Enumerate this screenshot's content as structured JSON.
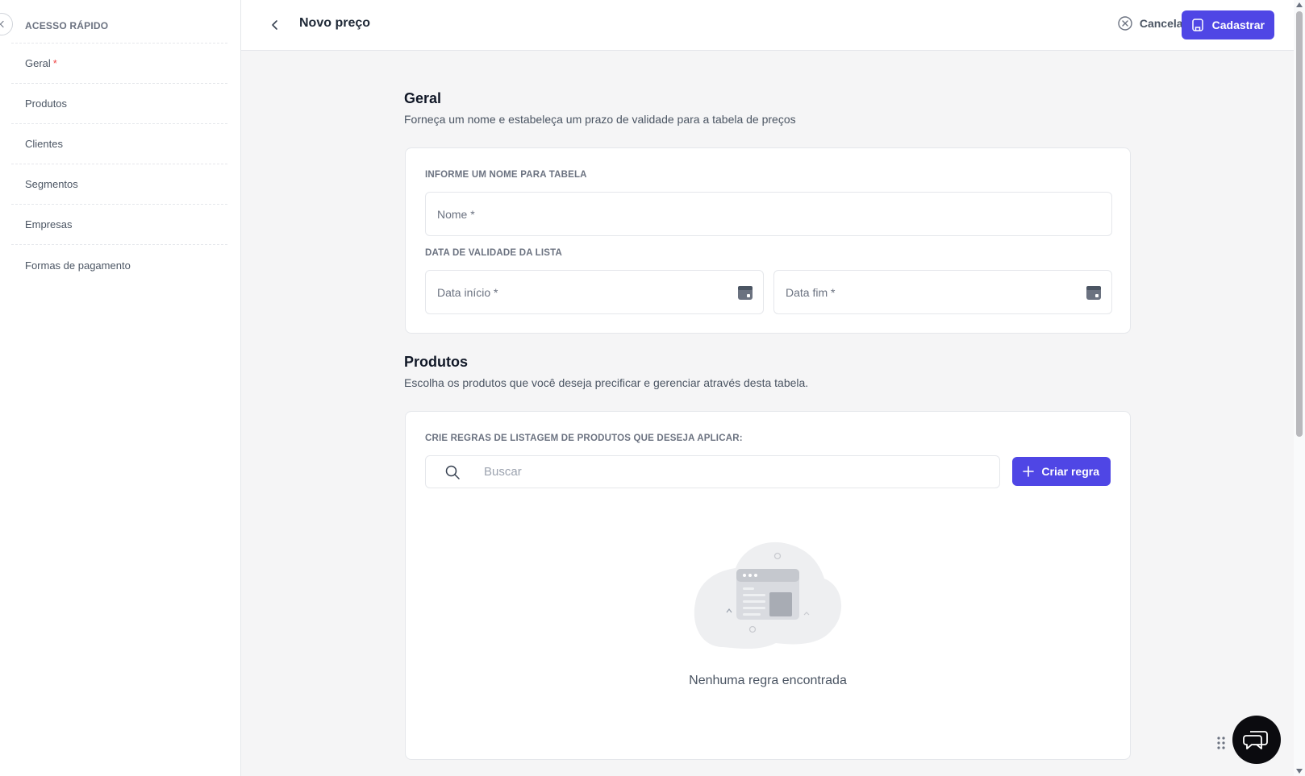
{
  "sidebar": {
    "heading": "ACESSO RÁPIDO",
    "items": [
      {
        "label": "Geral",
        "required": "*"
      },
      {
        "label": "Produtos"
      },
      {
        "label": "Clientes"
      },
      {
        "label": "Segmentos"
      },
      {
        "label": "Empresas"
      },
      {
        "label": "Formas de pagamento"
      }
    ]
  },
  "header": {
    "title": "Novo preço",
    "cancel_label": "Cancelar",
    "submit_label": "Cadastrar"
  },
  "general": {
    "title": "Geral",
    "description": "Forneça um nome e estabeleça um prazo de validade para a tabela de preços",
    "name_label": "INFORME UM NOME PARA TABELA",
    "name_placeholder": "Nome *",
    "validity_label": "DATA DE VALIDADE DA LISTA",
    "start_placeholder": "Data início *",
    "end_placeholder": "Data fim *"
  },
  "products": {
    "title": "Produtos",
    "description": "Escolha os produtos que você deseja precificar e gerenciar através desta tabela.",
    "rules_label": "CRIE REGRAS DE LISTAGEM DE PRODUTOS QUE DESEJA APLICAR:",
    "search_placeholder": "Buscar",
    "create_rule_label": "Criar regra",
    "empty_text": "Nenhuma regra encontrada"
  },
  "colors": {
    "primary": "#4f46e5",
    "background": "#f5f5f6",
    "required": "#ef4444"
  }
}
